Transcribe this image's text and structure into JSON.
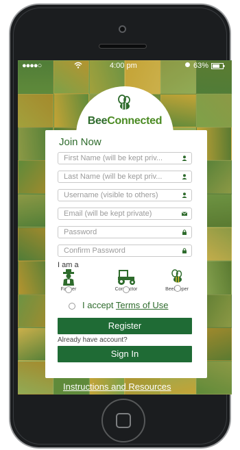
{
  "status_bar": {
    "signal": "●●●●○",
    "time": "4:00 pm",
    "battery": "63%"
  },
  "logo": {
    "part1": "Bee",
    "part2": "Connected"
  },
  "form": {
    "title": "Join Now",
    "fields": [
      {
        "placeholder": "First Name (will be kept priv...",
        "icon": "person-icon"
      },
      {
        "placeholder": "Last Name (will be kept priv...",
        "icon": "person-icon"
      },
      {
        "placeholder": "Username (visible to others)",
        "icon": "person-icon"
      },
      {
        "placeholder": "Email (will be kept private)",
        "icon": "envelope-icon"
      },
      {
        "placeholder": "Password",
        "icon": "lock-icon"
      },
      {
        "placeholder": "Confirm Password",
        "icon": "lock-icon"
      }
    ],
    "i_am_label": "I am a",
    "roles": [
      {
        "label": "Farmer",
        "icon": "farmer-icon"
      },
      {
        "label": "Contractor",
        "icon": "tractor-icon"
      },
      {
        "label": "Beekeeper",
        "icon": "bee-icon"
      }
    ],
    "terms_prefix": "I accept ",
    "terms_link": "Terms of Use",
    "register_label": "Register",
    "already_label": "Already have account?",
    "signin_label": "Sign In"
  },
  "instructions_link": "Instructions and Resources",
  "colors": {
    "brand_green": "#1f6b35",
    "phone_body": "#1b1d1f"
  }
}
